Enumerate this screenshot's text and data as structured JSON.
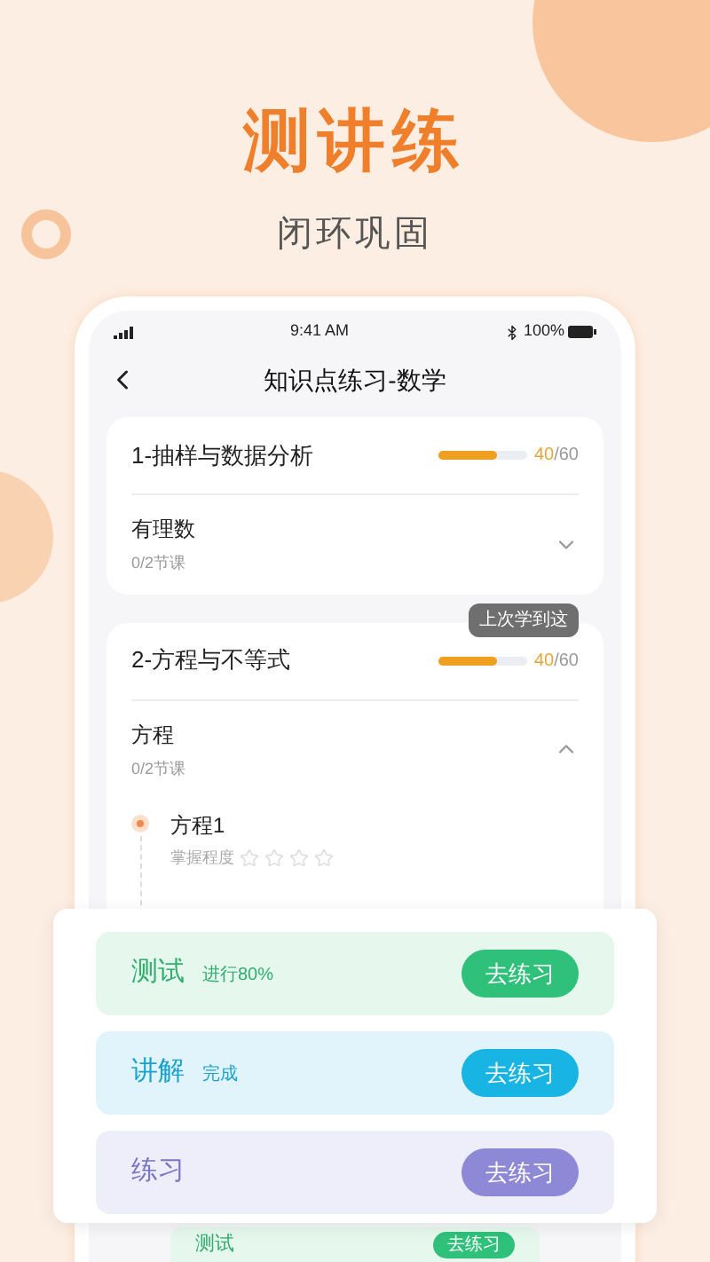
{
  "headline": "测讲练",
  "subheadline": "闭环巩固",
  "status_bar": {
    "time": "9:41 AM",
    "battery": "100%"
  },
  "nav": {
    "title": "知识点练习-数学"
  },
  "chapters": [
    {
      "title": "1-抽样与数据分析",
      "level": 0.67,
      "done": "40",
      "total": "/60",
      "sections": [
        {
          "name": "有理数",
          "progress": "0/2节课",
          "expanded": false
        }
      ]
    },
    {
      "title": "2-方程与不等式",
      "level": 0.67,
      "done": "40",
      "total": "/60",
      "tooltip": "上次学到这",
      "sections": [
        {
          "name": "方程",
          "progress": "0/2节课",
          "expanded": true,
          "lessons": [
            {
              "name": "方程1",
              "mastery_label": "掌握程度",
              "stars": 0
            }
          ]
        }
      ]
    }
  ],
  "steps": [
    {
      "kind": "test",
      "name": "测试",
      "status": "进行80%",
      "button": "去练习"
    },
    {
      "kind": "explain",
      "name": "讲解",
      "status": "完成",
      "button": "去练习"
    },
    {
      "kind": "practice",
      "name": "练习",
      "button": "去练习"
    }
  ],
  "peek_row": {
    "name": "测试",
    "button": "去练习"
  }
}
